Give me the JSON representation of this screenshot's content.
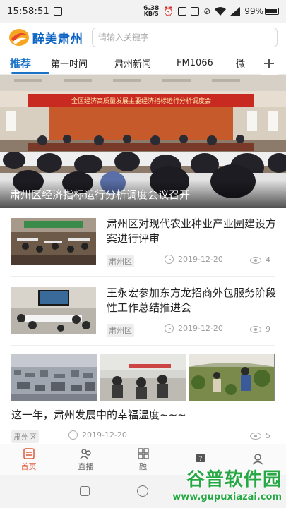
{
  "status_bar": {
    "time": "15:58:51",
    "speed_value": "6.38",
    "speed_unit": "KB/S",
    "battery": "99%"
  },
  "header": {
    "app_name": "醉美肃州",
    "search_placeholder": "请输入关键字"
  },
  "tabs": [
    {
      "label": "推荐",
      "active": true
    },
    {
      "label": "第一时间",
      "active": false
    },
    {
      "label": "肃州新闻",
      "active": false
    },
    {
      "label": "FM1066",
      "active": false
    },
    {
      "label": "微",
      "active": false
    }
  ],
  "hero": {
    "banner_text": "全区经济高质量发展主要经济指标运行分析调度会",
    "caption": "肃州区经济指标运行分析调度会议召开"
  },
  "news": [
    {
      "title": "肃州区对现代农业种业产业园建设方案进行评审",
      "tag": "肃州区",
      "date": "2019-12-20",
      "views": "4"
    },
    {
      "title": "王永宏参加东方龙招商外包服务阶段性工作总结推进会",
      "tag": "肃州区",
      "date": "2019-12-20",
      "views": "9"
    }
  ],
  "feature": {
    "title": "这一年，肃州发展中的幸福温度~~~",
    "tag": "肃州区",
    "date": "2019-12-20",
    "views": "5"
  },
  "bottom_nav": [
    {
      "label": "首页",
      "icon": "home-icon",
      "active": true
    },
    {
      "label": "直播",
      "icon": "live-icon",
      "active": false
    },
    {
      "label": "融",
      "icon": "grid-icon",
      "active": false
    },
    {
      "label": "",
      "icon": "question-icon",
      "active": false
    },
    {
      "label": "",
      "icon": "user-icon",
      "active": false
    }
  ],
  "watermark": {
    "title": "谷普软件园",
    "url": "www.gupuxiazai.com"
  },
  "colors": {
    "accent": "#1a73c8",
    "logo_text": "#0c64c4",
    "nav_active": "#e05a3a",
    "watermark": "#27a844"
  }
}
